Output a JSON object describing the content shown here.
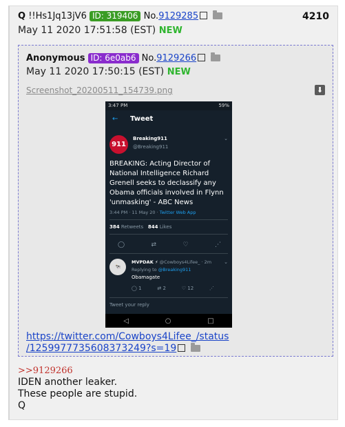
{
  "post": {
    "author": "Q",
    "tripcode": "!!Hs1Jq13jV6",
    "id_label": "ID: 319406",
    "no_prefix": "No.",
    "number": "9129285",
    "date": "May 11 2020 17:51:58 (EST)",
    "new_label": "NEW",
    "post_count": "4210",
    "quote_ref": ">>9129266",
    "lines": [
      "IDEN another leaker.",
      "These people are stupid.",
      "Q"
    ]
  },
  "quoted": {
    "author": "Anonymous",
    "id_label": "ID: 6e0ab6",
    "no_prefix": "No.",
    "number": "9129266",
    "date": "May 11 2020 17:50:15 (EST)",
    "new_label": "NEW",
    "filename": "Screenshot_20200511_154739.png",
    "url_line1": "https://twitter.com/Cowboys4Lifee_/status",
    "url_line2": "/1259977735608373249?s=19"
  },
  "screenshot": {
    "status_time": "3:47",
    "status_time_suffix": "PM",
    "battery": "59%",
    "header_title": "Tweet",
    "account_name": "Breaking911",
    "account_handle": "@Breaking911",
    "avatar_text": "911",
    "tweet_text": "BREAKING: Acting Director of National Intelligence Richard Grenell seeks to declassify any Obama officials involved in Flynn 'unmasking' - ABC News",
    "meta_time": "3:44 PM · 11 May 20 · ",
    "meta_source": "Twitter Web App",
    "retweets": "384",
    "retweets_label": "Retweets",
    "likes": "844",
    "likes_label": "Likes",
    "reply_name": "MVPDAK ⚡",
    "reply_handle": "@Cowboys4Lifee_ · 2m",
    "replying_to_prefix": "Replying to ",
    "replying_to": "@Breaking911",
    "reply_text": "Obamagate",
    "reply_replies": "1",
    "reply_retweets": "2",
    "reply_likes": "12",
    "reply_placeholder": "Tweet your reply"
  }
}
